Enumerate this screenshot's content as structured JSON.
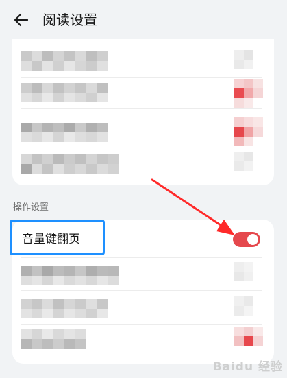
{
  "header": {
    "title": "阅读设置",
    "back_icon": "back-arrow-icon"
  },
  "sections": [
    {
      "label": ""
    },
    {
      "label": "操作设置"
    }
  ],
  "operation_settings": {
    "volume_key_page_turn": {
      "label": "音量键翻页",
      "enabled": true
    }
  },
  "obscured_rows_count": 7,
  "colors": {
    "accent": "#e5484d",
    "highlight": "#1e90ff",
    "annotation_arrow": "#ff2a2a"
  },
  "watermark": "Baidu 经验"
}
